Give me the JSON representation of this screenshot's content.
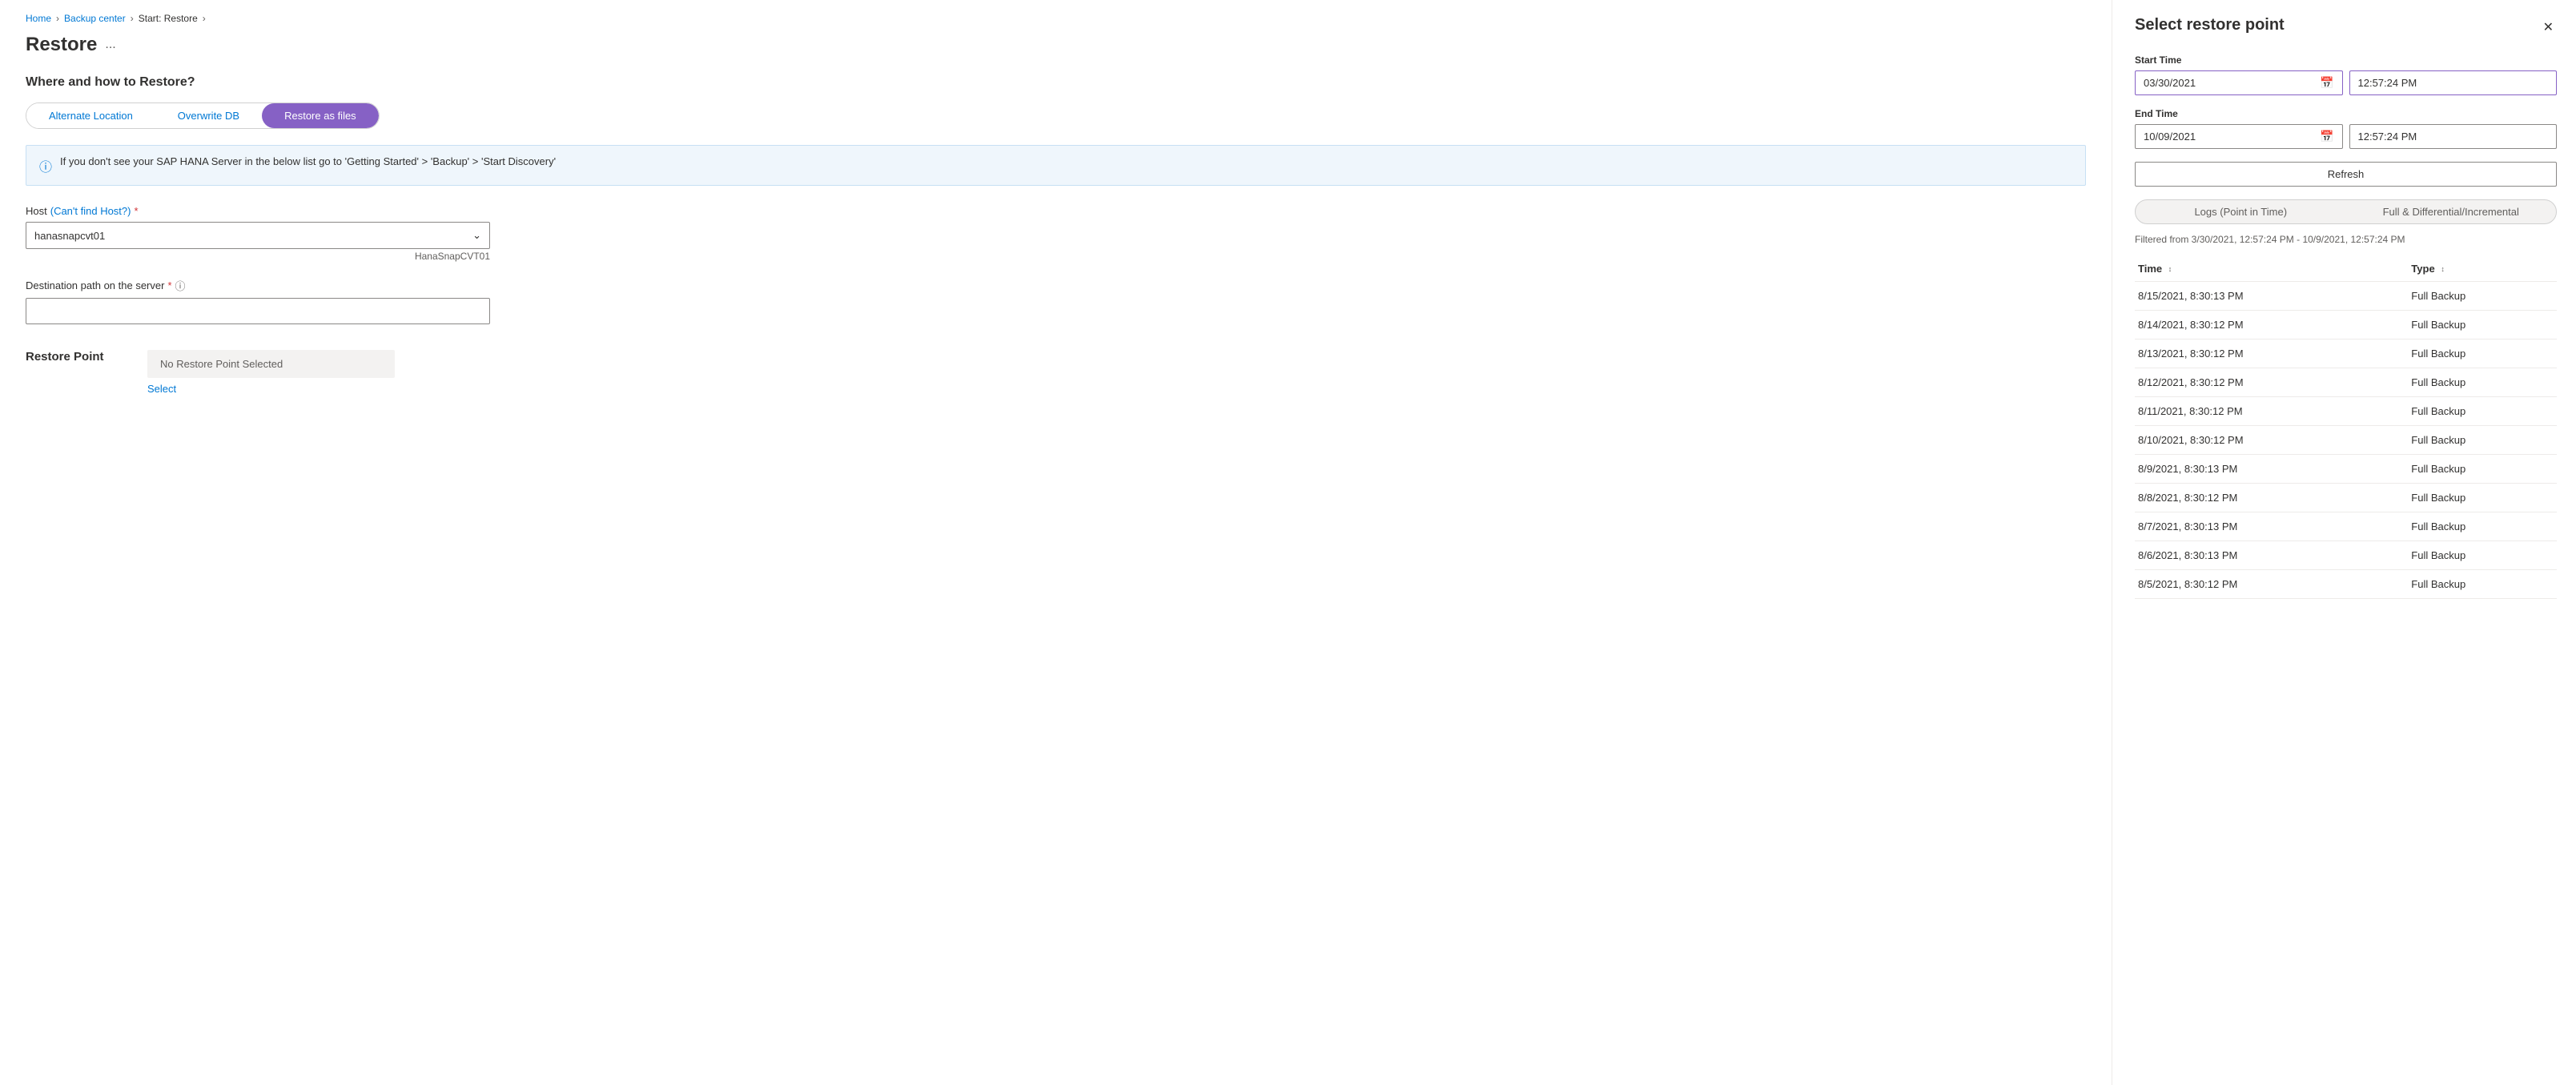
{
  "breadcrumb": {
    "home": "Home",
    "backup_center": "Backup center",
    "start_restore": "Start: Restore"
  },
  "page": {
    "title": "Restore",
    "ellipsis": "...",
    "section_title": "Where and how to Restore?"
  },
  "tabs": [
    {
      "id": "alternate",
      "label": "Alternate Location",
      "active": false
    },
    {
      "id": "overwrite",
      "label": "Overwrite DB",
      "active": false
    },
    {
      "id": "restore_files",
      "label": "Restore as files",
      "active": true
    }
  ],
  "info_box": {
    "text": "If you don't see your SAP HANA Server in the below list go to 'Getting Started' > 'Backup' > 'Start Discovery'"
  },
  "host_field": {
    "label": "Host",
    "cant_find": "(Can't find Host?)",
    "value": "hanasnapcvt01",
    "hint": "HanaSnapCVT01"
  },
  "destination_field": {
    "label": "Destination path on the server",
    "value": "",
    "placeholder": ""
  },
  "restore_point": {
    "label": "Restore Point",
    "no_selection_text": "No Restore Point Selected",
    "select_link": "Select"
  },
  "right_panel": {
    "title": "Select restore point",
    "start_time": {
      "label": "Start Time",
      "date": "03/30/2021",
      "time": "12:57:24 PM"
    },
    "end_time": {
      "label": "End Time",
      "date": "10/09/2021",
      "time": "12:57:24 PM"
    },
    "refresh_label": "Refresh",
    "log_tabs": [
      {
        "id": "logs",
        "label": "Logs (Point in Time)",
        "active": false
      },
      {
        "id": "full",
        "label": "Full & Differential/Incremental",
        "active": false
      }
    ],
    "filtered_text": "Filtered from 3/30/2021, 12:57:24 PM - 10/9/2021, 12:57:24 PM",
    "table_headers": [
      {
        "id": "time",
        "label": "Time"
      },
      {
        "id": "type",
        "label": "Type"
      }
    ],
    "table_rows": [
      {
        "time": "8/15/2021, 8:30:13 PM",
        "type": "Full Backup"
      },
      {
        "time": "8/14/2021, 8:30:12 PM",
        "type": "Full Backup"
      },
      {
        "time": "8/13/2021, 8:30:12 PM",
        "type": "Full Backup"
      },
      {
        "time": "8/12/2021, 8:30:12 PM",
        "type": "Full Backup"
      },
      {
        "time": "8/11/2021, 8:30:12 PM",
        "type": "Full Backup"
      },
      {
        "time": "8/10/2021, 8:30:12 PM",
        "type": "Full Backup"
      },
      {
        "time": "8/9/2021, 8:30:13 PM",
        "type": "Full Backup"
      },
      {
        "time": "8/8/2021, 8:30:12 PM",
        "type": "Full Backup"
      },
      {
        "time": "8/7/2021, 8:30:13 PM",
        "type": "Full Backup"
      },
      {
        "time": "8/6/2021, 8:30:13 PM",
        "type": "Full Backup"
      },
      {
        "time": "8/5/2021, 8:30:12 PM",
        "type": "Full Backup"
      }
    ]
  }
}
